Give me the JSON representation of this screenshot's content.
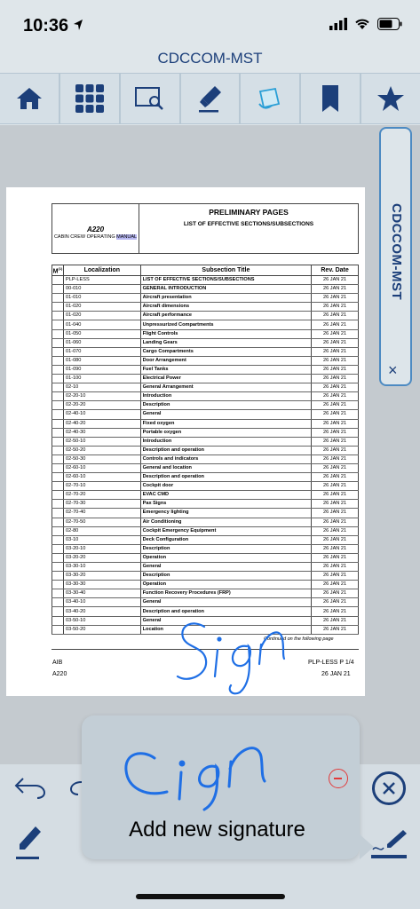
{
  "status_bar": {
    "time": "10:36"
  },
  "app_title": "CDCCOM-MST",
  "toolbar": {
    "items": [
      "home-icon",
      "grid-icon",
      "search-page-icon",
      "highlighter-icon",
      "annotate-icon",
      "bookmark-icon",
      "star-icon"
    ]
  },
  "side_tab": {
    "label": "CDCCOM-MST",
    "close": "×"
  },
  "document": {
    "model": "A220",
    "manual_prefix": "CABIN CREW OPERATING ",
    "manual_highlight": "MANUAL",
    "title1": "PRELIMINARY PAGES",
    "title2": "LIST OF EFFECTIVE SECTIONS/SUBSECTIONS",
    "columns": {
      "m": "M",
      "m_sup": "(1)",
      "localization": "Localization",
      "subsection": "Subsection Title",
      "rev": "Rev. Date"
    },
    "rows": [
      [
        "PLP-LESS",
        "LIST OF EFFECTIVE SECTIONS/SUBSECTIONS",
        "26 JAN 21"
      ],
      [
        "00-010",
        "GENERAL INTRODUCTION",
        "26 JAN 21"
      ],
      [
        "01-010",
        "Aircraft presentation",
        "26 JAN 21"
      ],
      [
        "01-020",
        "Aircraft dimensions",
        "26 JAN 21"
      ],
      [
        "01-020",
        "Aircraft performance",
        "26 JAN 21"
      ],
      [
        "01-040",
        "Unpressurized Compartments",
        "26 JAN 21"
      ],
      [
        "01-050",
        "Flight Controls",
        "26 JAN 21"
      ],
      [
        "01-060",
        "Landing Gears",
        "26 JAN 21"
      ],
      [
        "01-070",
        "Cargo Compartments",
        "26 JAN 21"
      ],
      [
        "01-080",
        "Door Arrangement",
        "26 JAN 21"
      ],
      [
        "01-090",
        "Fuel Tanks",
        "26 JAN 21"
      ],
      [
        "01-100",
        "Electrical Power",
        "26 JAN 21"
      ],
      [
        "02-10",
        "General Arrangement",
        "26 JAN 21"
      ],
      [
        "02-20-10",
        "Introduction",
        "26 JAN 21"
      ],
      [
        "02-20-20",
        "Description",
        "26 JAN 21"
      ],
      [
        "02-40-10",
        "General",
        "26 JAN 21"
      ],
      [
        "02-40-20",
        "Fixed oxygen",
        "26 JAN 21"
      ],
      [
        "02-40-30",
        "Portable oxygen",
        "26 JAN 21"
      ],
      [
        "02-50-10",
        "Introduction",
        "26 JAN 21"
      ],
      [
        "02-50-20",
        "Description and operation",
        "26 JAN 21"
      ],
      [
        "02-50-30",
        "Controls and indicators",
        "26 JAN 21"
      ],
      [
        "02-60-10",
        "General and location",
        "26 JAN 21"
      ],
      [
        "02-60-10",
        "Description and operation",
        "26 JAN 21"
      ],
      [
        "02-70-10",
        "Cockpit door",
        "26 JAN 21"
      ],
      [
        "02-70-20",
        "EVAC CMD",
        "26 JAN 21"
      ],
      [
        "02-70-30",
        "Pax Signs",
        "26 JAN 21"
      ],
      [
        "02-70-40",
        "Emergency lighting",
        "26 JAN 21"
      ],
      [
        "02-70-50",
        "Air Conditioning",
        "26 JAN 21"
      ],
      [
        "02-80",
        "Cockpit Emergency Equipment",
        "26 JAN 21"
      ],
      [
        "03-10",
        "Deck Configuration",
        "26 JAN 21"
      ],
      [
        "03-20-10",
        "Description",
        "26 JAN 21"
      ],
      [
        "03-20-20",
        "Operation",
        "26 JAN 21"
      ],
      [
        "03-30-10",
        "General",
        "26 JAN 21"
      ],
      [
        "03-30-20",
        "Description",
        "26 JAN 21"
      ],
      [
        "03-30-30",
        "Operation",
        "26 JAN 21"
      ],
      [
        "03-30-40",
        "Function Recovery Procedures (FRP)",
        "26 JAN 21"
      ],
      [
        "03-40-10",
        "General",
        "26 JAN 21"
      ],
      [
        "03-40-20",
        "Description and operation",
        "26 JAN 21"
      ],
      [
        "03-50-10",
        "General",
        "26 JAN 21"
      ],
      [
        "03-50-20",
        "Location",
        "26 JAN 21"
      ]
    ],
    "continued": "Continued on the following page",
    "footer_left1": "AIB",
    "footer_left2": "A220",
    "footer_right1": "PLP-LESS P 1/4",
    "footer_right2": "26 JAN 21"
  },
  "signature_popover": {
    "label": "Add new signature"
  },
  "colors": {
    "accent": "#1c3f7a",
    "ink_blue": "#1f6fe5",
    "delete_red": "#e23a3a"
  }
}
